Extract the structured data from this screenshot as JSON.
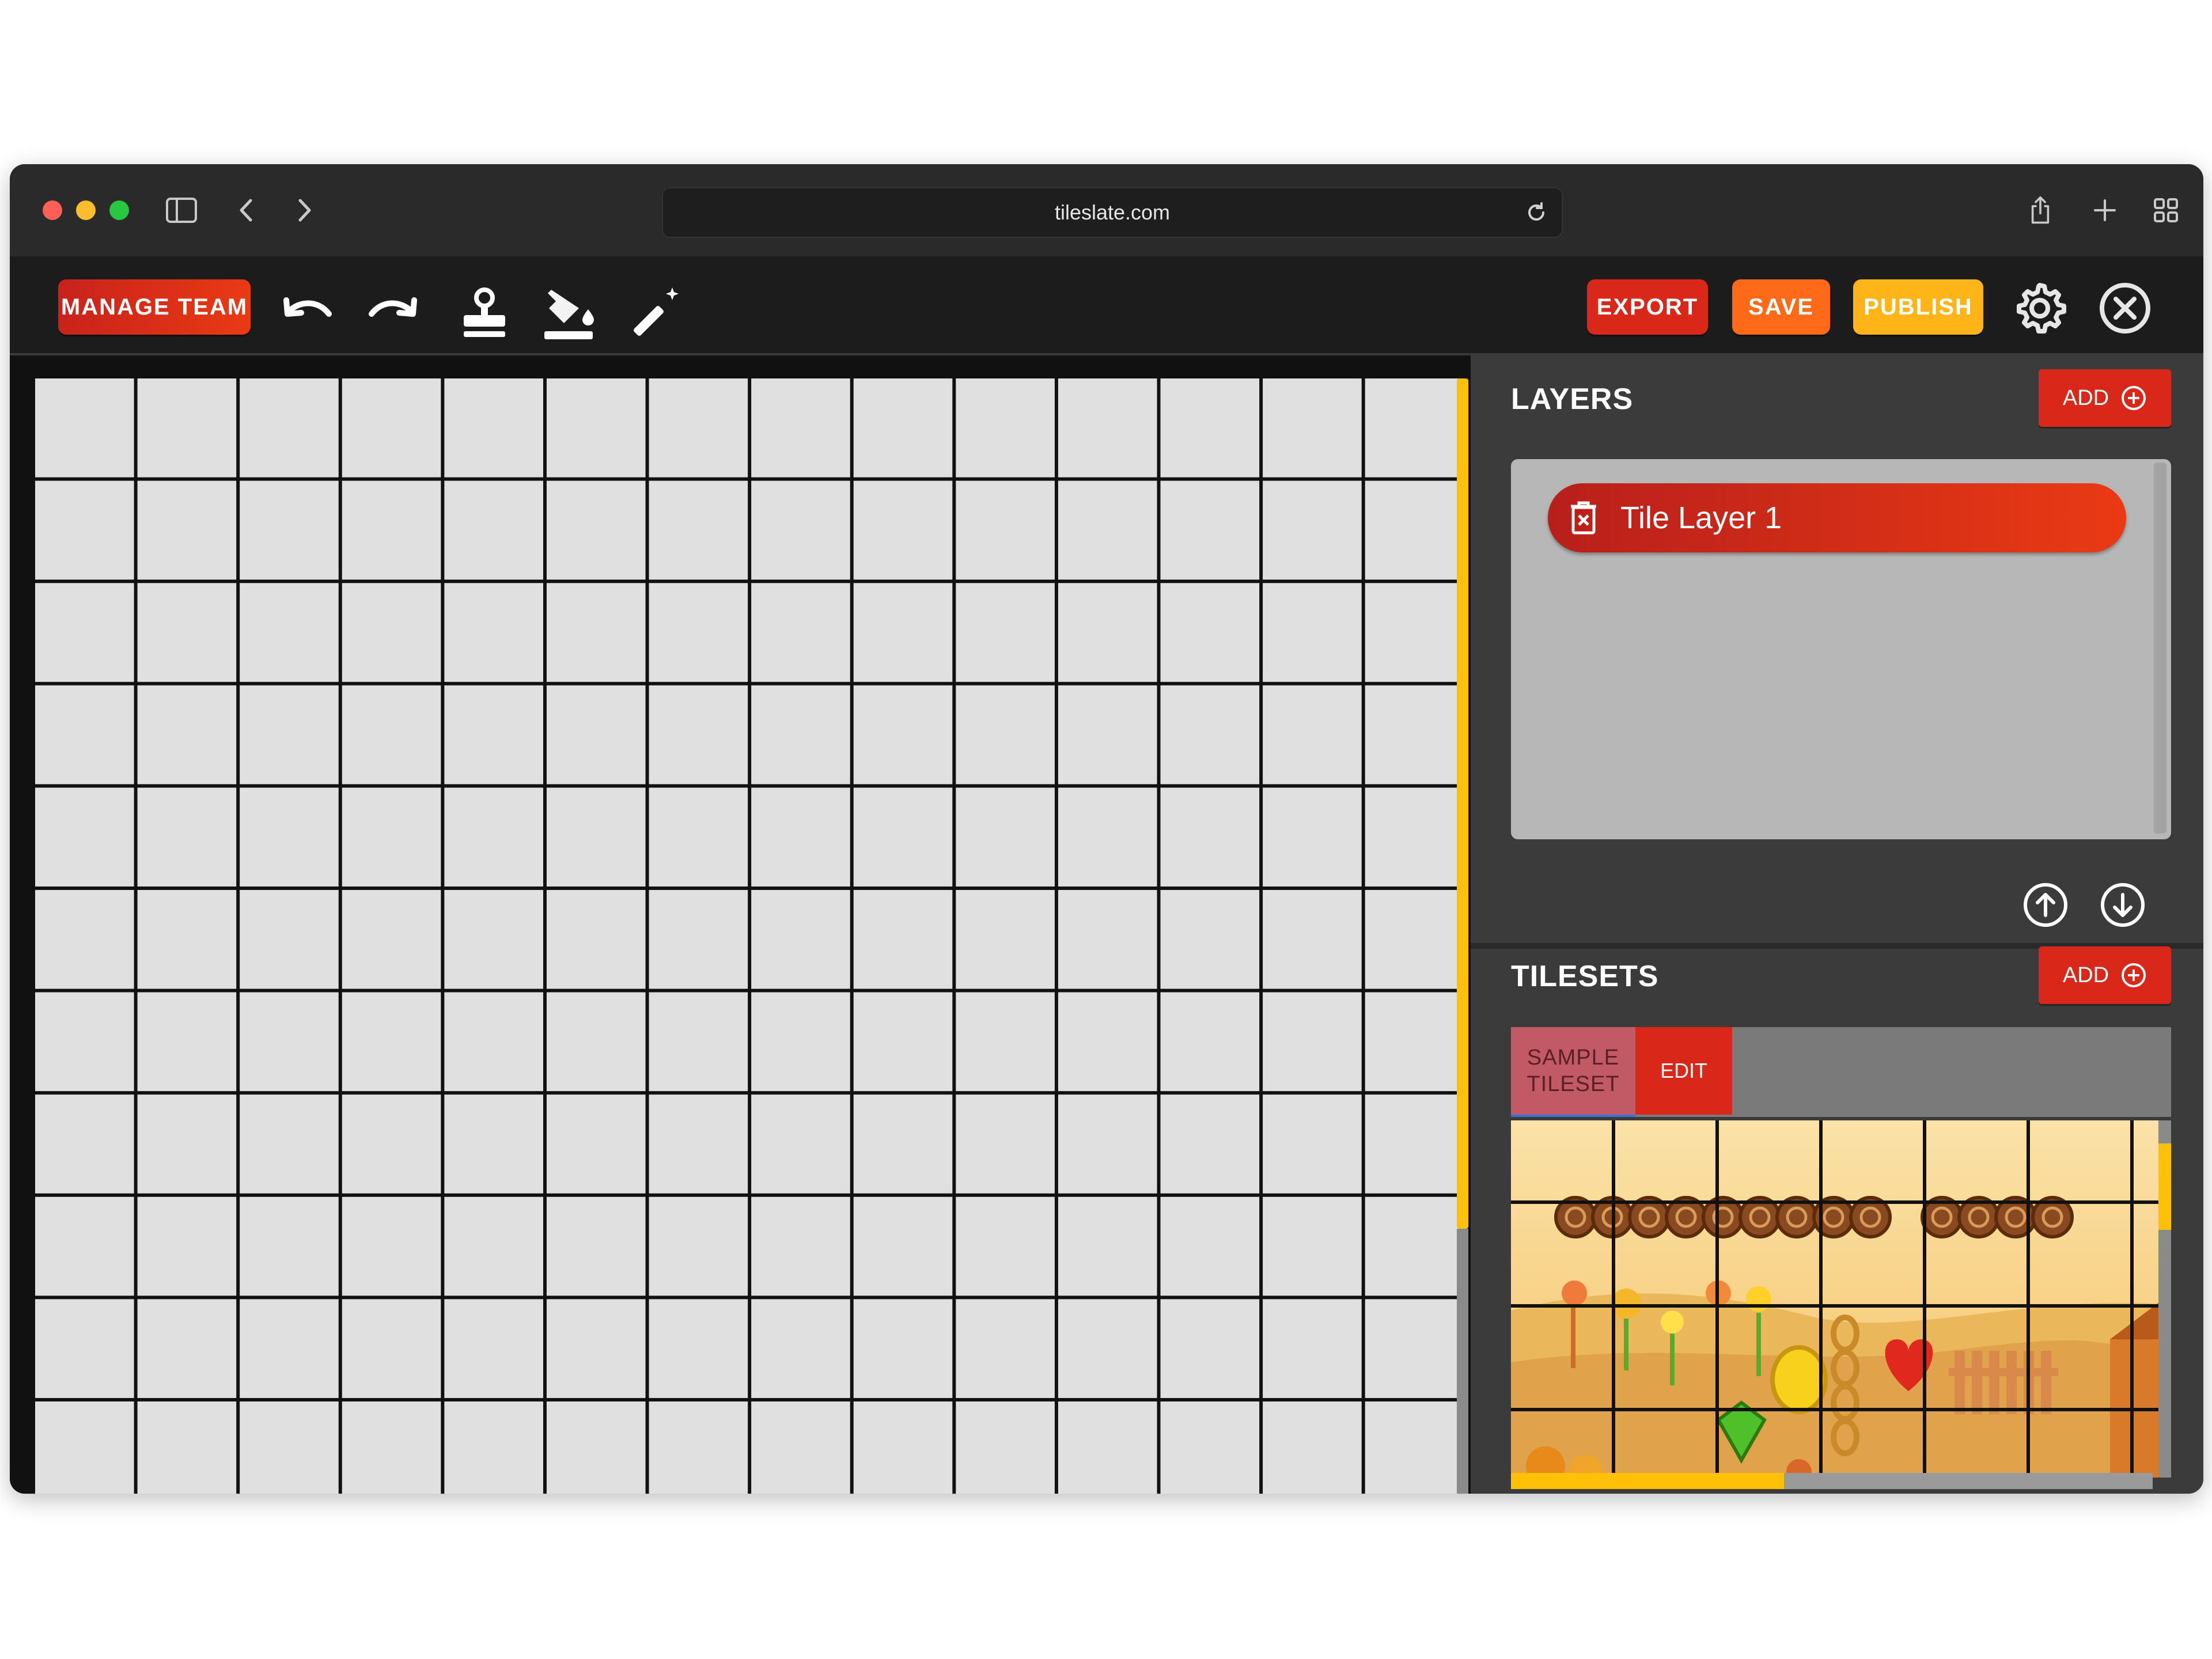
{
  "browser": {
    "url": "tileslate.com"
  },
  "toolbar": {
    "manage_team_label": "MANAGE TEAM",
    "export_label": "EXPORT",
    "save_label": "SAVE",
    "publish_label": "PUBLISH",
    "tools": [
      "undo-icon",
      "redo-icon",
      "stamp-icon",
      "fill-icon",
      "magic-wand-icon"
    ]
  },
  "layers": {
    "title": "LAYERS",
    "add_label": "ADD",
    "items": [
      {
        "label": "Tile Layer 1"
      }
    ]
  },
  "tilesets": {
    "title": "TILESETS",
    "add_label": "ADD",
    "tabs": [
      {
        "label_line1": "SAMPLE",
        "label_line2": "TILESET"
      }
    ],
    "edit_label": "EDIT"
  },
  "colors": {
    "accent_red": "#d9281a",
    "save_orange": "#ff6a18",
    "publish_yellow": "#ffb417",
    "scroll_yellow": "#ffc107"
  }
}
